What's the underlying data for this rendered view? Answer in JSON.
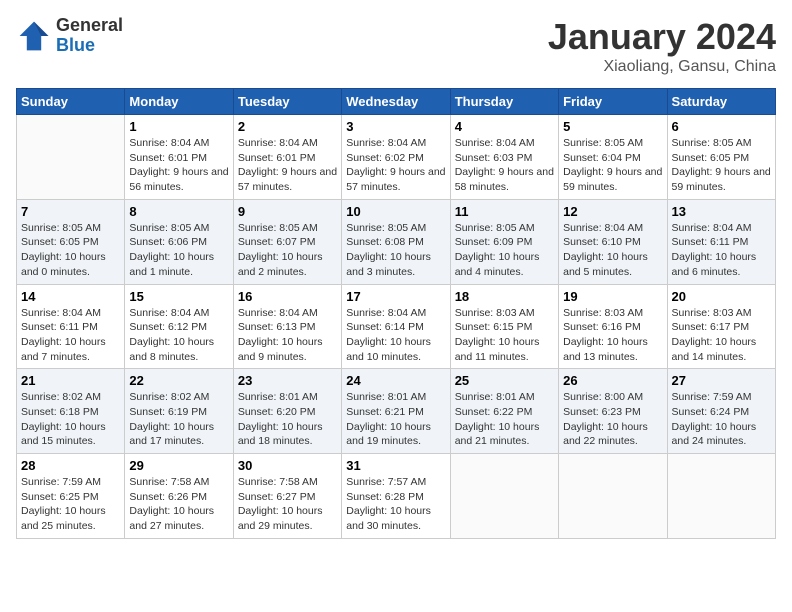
{
  "header": {
    "logo_general": "General",
    "logo_blue": "Blue",
    "month_title": "January 2024",
    "location": "Xiaoliang, Gansu, China"
  },
  "columns": [
    "Sunday",
    "Monday",
    "Tuesday",
    "Wednesday",
    "Thursday",
    "Friday",
    "Saturday"
  ],
  "weeks": [
    [
      {
        "day": "",
        "sunrise": "",
        "sunset": "",
        "daylight": ""
      },
      {
        "day": "1",
        "sunrise": "Sunrise: 8:04 AM",
        "sunset": "Sunset: 6:01 PM",
        "daylight": "Daylight: 9 hours and 56 minutes."
      },
      {
        "day": "2",
        "sunrise": "Sunrise: 8:04 AM",
        "sunset": "Sunset: 6:01 PM",
        "daylight": "Daylight: 9 hours and 57 minutes."
      },
      {
        "day": "3",
        "sunrise": "Sunrise: 8:04 AM",
        "sunset": "Sunset: 6:02 PM",
        "daylight": "Daylight: 9 hours and 57 minutes."
      },
      {
        "day": "4",
        "sunrise": "Sunrise: 8:04 AM",
        "sunset": "Sunset: 6:03 PM",
        "daylight": "Daylight: 9 hours and 58 minutes."
      },
      {
        "day": "5",
        "sunrise": "Sunrise: 8:05 AM",
        "sunset": "Sunset: 6:04 PM",
        "daylight": "Daylight: 9 hours and 59 minutes."
      },
      {
        "day": "6",
        "sunrise": "Sunrise: 8:05 AM",
        "sunset": "Sunset: 6:05 PM",
        "daylight": "Daylight: 9 hours and 59 minutes."
      }
    ],
    [
      {
        "day": "7",
        "sunrise": "Sunrise: 8:05 AM",
        "sunset": "Sunset: 6:05 PM",
        "daylight": "Daylight: 10 hours and 0 minutes."
      },
      {
        "day": "8",
        "sunrise": "Sunrise: 8:05 AM",
        "sunset": "Sunset: 6:06 PM",
        "daylight": "Daylight: 10 hours and 1 minute."
      },
      {
        "day": "9",
        "sunrise": "Sunrise: 8:05 AM",
        "sunset": "Sunset: 6:07 PM",
        "daylight": "Daylight: 10 hours and 2 minutes."
      },
      {
        "day": "10",
        "sunrise": "Sunrise: 8:05 AM",
        "sunset": "Sunset: 6:08 PM",
        "daylight": "Daylight: 10 hours and 3 minutes."
      },
      {
        "day": "11",
        "sunrise": "Sunrise: 8:05 AM",
        "sunset": "Sunset: 6:09 PM",
        "daylight": "Daylight: 10 hours and 4 minutes."
      },
      {
        "day": "12",
        "sunrise": "Sunrise: 8:04 AM",
        "sunset": "Sunset: 6:10 PM",
        "daylight": "Daylight: 10 hours and 5 minutes."
      },
      {
        "day": "13",
        "sunrise": "Sunrise: 8:04 AM",
        "sunset": "Sunset: 6:11 PM",
        "daylight": "Daylight: 10 hours and 6 minutes."
      }
    ],
    [
      {
        "day": "14",
        "sunrise": "Sunrise: 8:04 AM",
        "sunset": "Sunset: 6:11 PM",
        "daylight": "Daylight: 10 hours and 7 minutes."
      },
      {
        "day": "15",
        "sunrise": "Sunrise: 8:04 AM",
        "sunset": "Sunset: 6:12 PM",
        "daylight": "Daylight: 10 hours and 8 minutes."
      },
      {
        "day": "16",
        "sunrise": "Sunrise: 8:04 AM",
        "sunset": "Sunset: 6:13 PM",
        "daylight": "Daylight: 10 hours and 9 minutes."
      },
      {
        "day": "17",
        "sunrise": "Sunrise: 8:04 AM",
        "sunset": "Sunset: 6:14 PM",
        "daylight": "Daylight: 10 hours and 10 minutes."
      },
      {
        "day": "18",
        "sunrise": "Sunrise: 8:03 AM",
        "sunset": "Sunset: 6:15 PM",
        "daylight": "Daylight: 10 hours and 11 minutes."
      },
      {
        "day": "19",
        "sunrise": "Sunrise: 8:03 AM",
        "sunset": "Sunset: 6:16 PM",
        "daylight": "Daylight: 10 hours and 13 minutes."
      },
      {
        "day": "20",
        "sunrise": "Sunrise: 8:03 AM",
        "sunset": "Sunset: 6:17 PM",
        "daylight": "Daylight: 10 hours and 14 minutes."
      }
    ],
    [
      {
        "day": "21",
        "sunrise": "Sunrise: 8:02 AM",
        "sunset": "Sunset: 6:18 PM",
        "daylight": "Daylight: 10 hours and 15 minutes."
      },
      {
        "day": "22",
        "sunrise": "Sunrise: 8:02 AM",
        "sunset": "Sunset: 6:19 PM",
        "daylight": "Daylight: 10 hours and 17 minutes."
      },
      {
        "day": "23",
        "sunrise": "Sunrise: 8:01 AM",
        "sunset": "Sunset: 6:20 PM",
        "daylight": "Daylight: 10 hours and 18 minutes."
      },
      {
        "day": "24",
        "sunrise": "Sunrise: 8:01 AM",
        "sunset": "Sunset: 6:21 PM",
        "daylight": "Daylight: 10 hours and 19 minutes."
      },
      {
        "day": "25",
        "sunrise": "Sunrise: 8:01 AM",
        "sunset": "Sunset: 6:22 PM",
        "daylight": "Daylight: 10 hours and 21 minutes."
      },
      {
        "day": "26",
        "sunrise": "Sunrise: 8:00 AM",
        "sunset": "Sunset: 6:23 PM",
        "daylight": "Daylight: 10 hours and 22 minutes."
      },
      {
        "day": "27",
        "sunrise": "Sunrise: 7:59 AM",
        "sunset": "Sunset: 6:24 PM",
        "daylight": "Daylight: 10 hours and 24 minutes."
      }
    ],
    [
      {
        "day": "28",
        "sunrise": "Sunrise: 7:59 AM",
        "sunset": "Sunset: 6:25 PM",
        "daylight": "Daylight: 10 hours and 25 minutes."
      },
      {
        "day": "29",
        "sunrise": "Sunrise: 7:58 AM",
        "sunset": "Sunset: 6:26 PM",
        "daylight": "Daylight: 10 hours and 27 minutes."
      },
      {
        "day": "30",
        "sunrise": "Sunrise: 7:58 AM",
        "sunset": "Sunset: 6:27 PM",
        "daylight": "Daylight: 10 hours and 29 minutes."
      },
      {
        "day": "31",
        "sunrise": "Sunrise: 7:57 AM",
        "sunset": "Sunset: 6:28 PM",
        "daylight": "Daylight: 10 hours and 30 minutes."
      },
      {
        "day": "",
        "sunrise": "",
        "sunset": "",
        "daylight": ""
      },
      {
        "day": "",
        "sunrise": "",
        "sunset": "",
        "daylight": ""
      },
      {
        "day": "",
        "sunrise": "",
        "sunset": "",
        "daylight": ""
      }
    ]
  ]
}
